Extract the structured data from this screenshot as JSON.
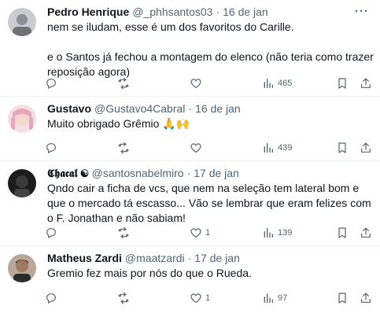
{
  "tweets": [
    {
      "name": "Pedro Henrique",
      "handle": "@_phhsantos03",
      "dot": "·",
      "time": "16 de jan",
      "text": "nem se iludam, esse é um dos favoritos do Carille.\n\ne o Santos já fechou a montagem do elenco (não teria como trazer reposição agora)",
      "replies": "",
      "retweets": "",
      "likes": "",
      "views": "465",
      "avatar_color": "#c7c9cc"
    },
    {
      "name": "Gustavo",
      "handle": "@Gustavo4Cabral",
      "dot": "·",
      "time": "16 de jan",
      "text": "Muito obrigado Grêmio 🙏🙌",
      "replies": "",
      "retweets": "",
      "likes": "",
      "views": "439",
      "avatar_color": "#e8b9c0"
    },
    {
      "name": "𝕮𝖍𝖆𝖈𝖆𝖑 ☯",
      "handle": "@santosnabelmiro",
      "dot": "·",
      "time": "17 de jan",
      "text": "Qndo cair a ficha de vcs, que nem na seleção tem lateral bom e que o mercado tá escasso... Vão se lembrar que eram felizes com o F. Jonathan e não sabiam!",
      "replies": "",
      "retweets": "",
      "likes": "1",
      "views": "139",
      "avatar_color": "#2a2a2a"
    },
    {
      "name": "Matheus Zardi",
      "handle": "@maatzardi",
      "dot": "·",
      "time": "17 de jan",
      "text": "Gremio fez mais por nós do que o Rueda.",
      "replies": "",
      "retweets": "",
      "likes": "1",
      "views": "97",
      "avatar_color": "#8a6a55"
    }
  ],
  "icons": {
    "more": "more-options-icon",
    "reply": "reply-icon",
    "retweet": "retweet-icon",
    "like": "like-icon",
    "views": "views-icon",
    "bookmark": "bookmark-icon",
    "share": "share-icon"
  },
  "more_glyph": "···"
}
